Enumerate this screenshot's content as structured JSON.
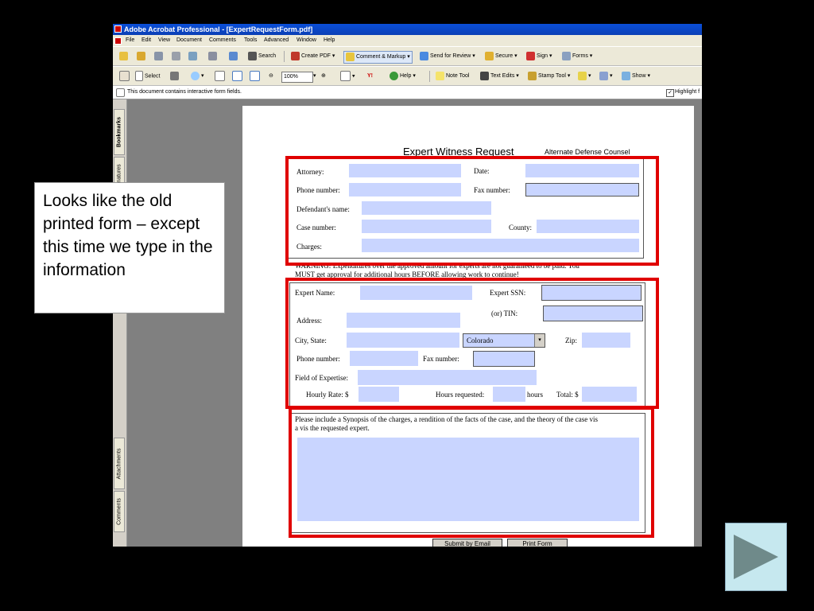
{
  "window": {
    "title": "Adobe Acrobat Professional - [ExpertRequestForm.pdf]",
    "menu": [
      "File",
      "Edit",
      "View",
      "Document",
      "Comments",
      "Tools",
      "Advanced",
      "Window",
      "Help"
    ]
  },
  "toolbar1": {
    "search": "Search",
    "create_pdf": "Create PDF",
    "comment_markup": "Comment & Markup",
    "send_review": "Send for Review",
    "secure": "Secure",
    "sign": "Sign",
    "forms": "Forms"
  },
  "toolbar2": {
    "select": "Select",
    "zoom": "100%",
    "help": "Help",
    "note_tool": "Note Tool",
    "text_edits": "Text Edits",
    "stamp_tool": "Stamp Tool",
    "show": "Show"
  },
  "message_bar": {
    "text": "This document contains interactive form fields.",
    "highlight_label": "Highlight f"
  },
  "nav_tabs": {
    "bookmarks": "Bookmarks",
    "signatures": "natures",
    "attachments": "Attachments",
    "comments": "Comments"
  },
  "form": {
    "title": "Expert Witness Request",
    "org": "Alternate Defense Counsel",
    "attorney": "Attorney:",
    "date": "Date:",
    "phone": "Phone number:",
    "fax": "Fax number:",
    "defendant": "Defendant's name:",
    "case": "Case number:",
    "county": "County:",
    "charges": "Charges:",
    "warning1": "WARNING! Expenditures over the approved amount for experts are not guaranteed to be paid. You",
    "warning2": "MUST get approval for additional hours BEFORE allowing work to continue!",
    "expert_name": "Expert Name:",
    "expert_ssn": "Expert SSN:",
    "tin": "(or) TIN:",
    "address": "Address:",
    "city_state": "City, State:",
    "state_value": "Colorado",
    "zip": "Zip:",
    "phone2": "Phone number:",
    "fax2": "Fax number:",
    "field_expertise": "Field of Expertise:",
    "hourly_rate": "Hourly Rate: $",
    "hours_requested": "Hours requested:",
    "hours": "hours",
    "total": "Total: $",
    "synopsis1": "Please include a Synopsis of the charges, a rendition of the facts of the case, and the theory of the case vis",
    "synopsis2": "a vis the requested expert.",
    "submit": "Submit by Email",
    "print": "Print Form"
  },
  "callout": {
    "text": "Looks like the old printed form – except this time we type in the information"
  },
  "colors": {
    "field_fill": "#c9d5ff",
    "highlight": "#e00000",
    "titlebar": "#0a4fd8"
  },
  "icons": [
    "play-next-icon",
    "hand-icon",
    "select-icon",
    "zoom-icon",
    "help-icon"
  ]
}
